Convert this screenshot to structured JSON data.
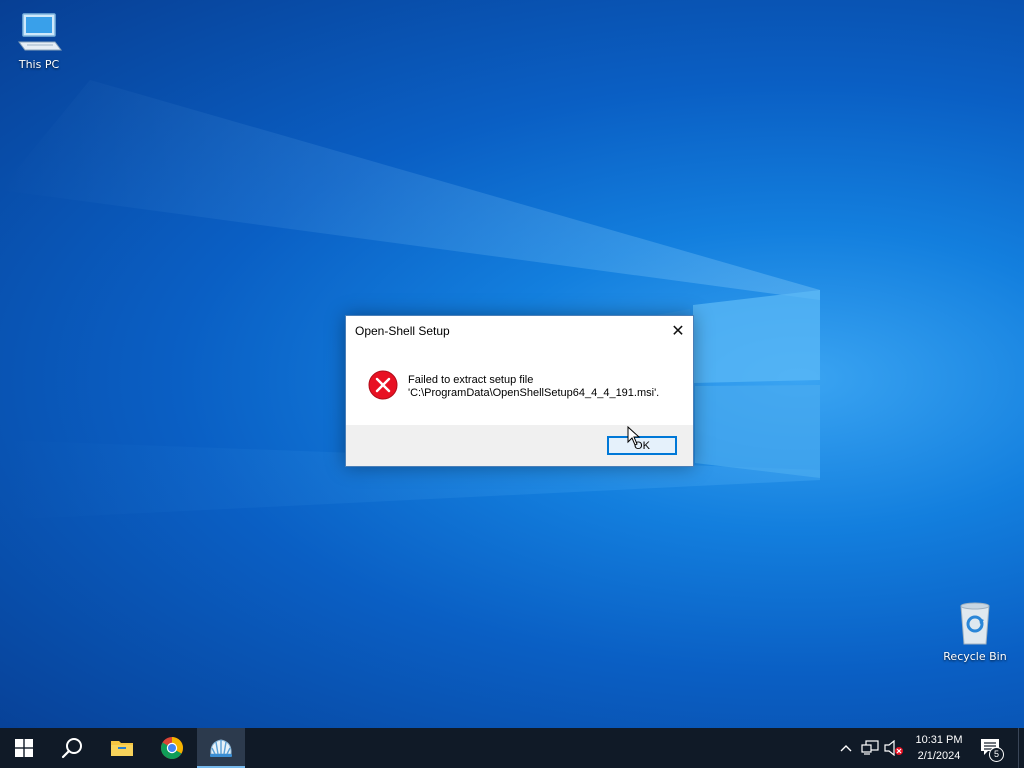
{
  "desktop": {
    "icons": [
      {
        "label": "This PC",
        "icon": "computer-icon"
      },
      {
        "label": "Recycle Bin",
        "icon": "recycle-bin-icon"
      }
    ],
    "colors": {
      "wallpaper_base": "#0a5fc4",
      "wallpaper_light": "#3aa4f2"
    }
  },
  "dialog": {
    "title": "Open-Shell Setup",
    "close_glyph": "✕",
    "icon": "error-icon",
    "message_line1": "Failed to extract setup file",
    "message_line2": "'C:\\ProgramData\\OpenShellSetup64_4_4_191.msi'.",
    "ok_label": "OK",
    "colors": {
      "error_red": "#e81123",
      "button_border": "#0078d7"
    }
  },
  "taskbar": {
    "pinned": [
      {
        "name": "start",
        "icon": "windows-logo-icon"
      },
      {
        "name": "search",
        "icon": "search-icon"
      },
      {
        "name": "file-explorer",
        "icon": "folder-icon"
      },
      {
        "name": "chrome",
        "icon": "chrome-icon"
      },
      {
        "name": "open-shell-setup",
        "icon": "shell-icon",
        "active": true
      }
    ],
    "tray": {
      "chevron_icon": "chevron-up-icon",
      "network_icon": "network-icon",
      "volume_icon": "volume-muted-icon"
    },
    "clock": {
      "time": "10:31 PM",
      "date": "2/1/2024"
    },
    "notifications": {
      "icon": "action-center-icon",
      "count": "5"
    },
    "colors": {
      "background": "#101a27",
      "active_underline": "#76b9ed"
    }
  }
}
